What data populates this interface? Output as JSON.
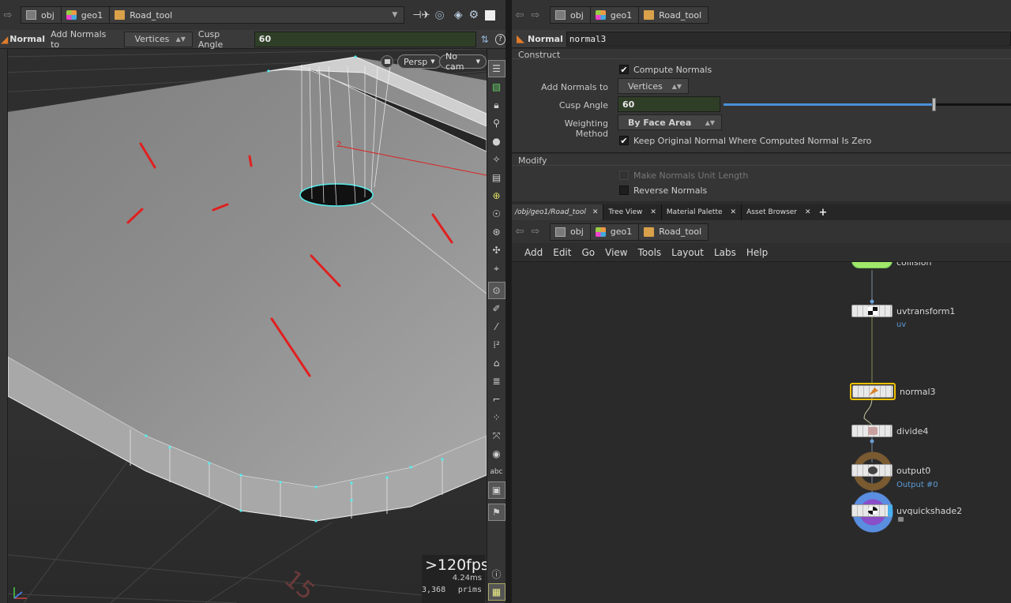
{
  "left": {
    "path": {
      "obj": "obj",
      "geo": "geo1",
      "road": "Road_tool"
    },
    "toolbar": {
      "node_label": "Normal",
      "add_normals_label": "Add Normals to",
      "add_normals_value": "Vertices",
      "cusp_angle_label": "Cusp Angle",
      "cusp_angle_value": "60"
    },
    "viewport": {
      "persp": "Persp",
      "cam": "No cam",
      "fps": ">120fps",
      "ms": "4.24ms",
      "prims_count": "3,368",
      "prims_label": "prims",
      "grid_number": "15",
      "edge_number": "2"
    },
    "tools": [
      "abc"
    ]
  },
  "right": {
    "path": {
      "obj": "obj",
      "geo": "geo1",
      "road": "Road_tool"
    },
    "param": {
      "node_type": "Normal",
      "node_name": "normal3",
      "construct_label": "Construct",
      "compute_normals": "Compute Normals",
      "add_normals_label": "Add Normals to",
      "add_normals_value": "Vertices",
      "cusp_angle_label": "Cusp Angle",
      "cusp_angle_value": "60",
      "cusp_slider_fraction": 0.73,
      "weighting_label": "Weighting Method",
      "weighting_value": "By Face Area",
      "keep_original": "Keep Original Normal Where Computed Normal Is Zero",
      "modify_label": "Modify",
      "unit_length": "Make Normals Unit Length",
      "reverse": "Reverse Normals"
    },
    "tabs": [
      "/obj/geo1/Road_tool",
      "Tree View",
      "Material Palette",
      "Asset Browser"
    ],
    "network_path": {
      "obj": "obj",
      "geo": "geo1",
      "road": "Road_tool"
    },
    "menu": [
      "Add",
      "Edit",
      "Go",
      "View",
      "Tools",
      "Layout",
      "Labs",
      "Help"
    ],
    "nodes": {
      "collision": "collision",
      "uvtransform": "uvtransform1",
      "uvtransform_sub": "uv",
      "normal": "normal3",
      "divide": "divide4",
      "output": "output0",
      "output_sub": "Output #0",
      "uvquickshade": "uvquickshade2"
    }
  },
  "colors": {
    "arrow": "#e02020",
    "field_green": "#2f3f27",
    "node_selected": "#f0c000",
    "link_blue": "#5b9bd5"
  }
}
